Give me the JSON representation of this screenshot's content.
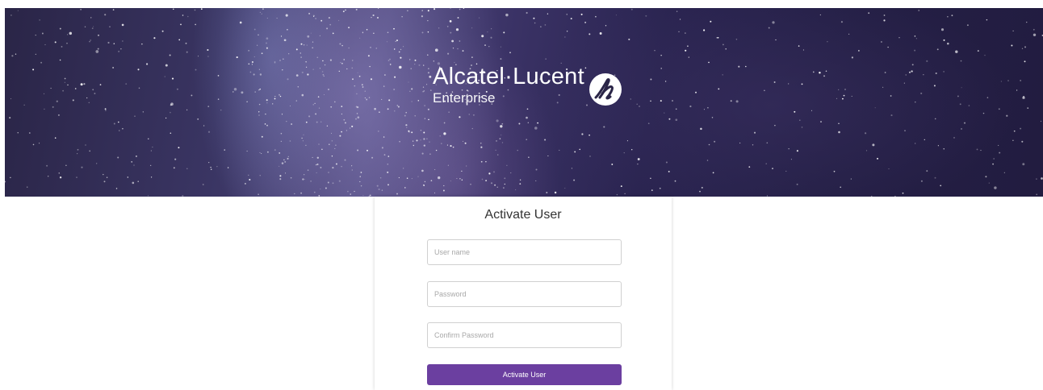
{
  "banner": {
    "logo_brand": "Alcatel·Lucent",
    "logo_sub": "Enterprise"
  },
  "form": {
    "title": "Activate User",
    "username": {
      "value": "",
      "placeholder": "User name"
    },
    "password": {
      "value": "",
      "placeholder": "Password"
    },
    "confirm_password": {
      "value": "",
      "placeholder": "Confirm Password"
    },
    "submit_label": "Activate User"
  },
  "colors": {
    "accent": "#6b3fa0",
    "banner_bg": "#2a2547"
  }
}
